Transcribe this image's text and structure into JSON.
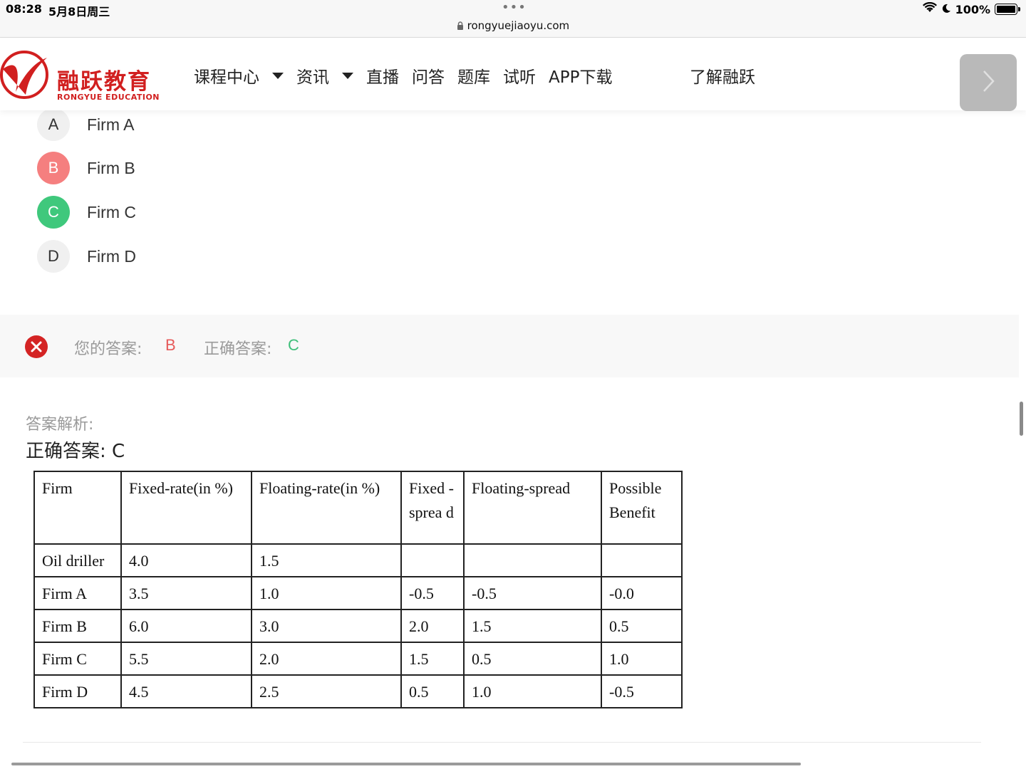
{
  "status_bar": {
    "time": "08:28",
    "date": "5月8日周三",
    "url": "rongyuejiaoyu.com",
    "battery": "100%"
  },
  "header": {
    "logo_cn": "融跃教育",
    "logo_en": "RONGYUE EDUCATION",
    "nav": [
      "课程中心",
      "资讯",
      "直播",
      "问答",
      "题库",
      "试听",
      "APP下载"
    ],
    "about": "了解融跃"
  },
  "options": [
    {
      "letter": "A",
      "text": "Firm A",
      "state": "normal"
    },
    {
      "letter": "B",
      "text": "Firm B",
      "state": "wrong"
    },
    {
      "letter": "C",
      "text": "Firm C",
      "state": "correct"
    },
    {
      "letter": "D",
      "text": "Firm D",
      "state": "normal"
    }
  ],
  "answer": {
    "your_label": "您的答案:",
    "your_value": "B",
    "correct_label": "正确答案:",
    "correct_value": "C",
    "colors": {
      "wrong": "#e65a5a",
      "correct": "#3fbf7a"
    }
  },
  "analysis": {
    "label": "答案解析:",
    "correct_line": "正确答案: C"
  },
  "table": {
    "headers": [
      "Firm",
      "Fixed-rate(in %)",
      "Floating-rate(in %)",
      "Fixed -sprea d",
      "Floating-spread",
      "Possible Benefit"
    ],
    "rows": [
      [
        "Oil driller",
        "4.0",
        "1.5",
        "",
        "",
        ""
      ],
      [
        "Firm A",
        "3.5",
        "1.0",
        "-0.5",
        "-0.5",
        "-0.0"
      ],
      [
        "Firm B",
        "6.0",
        "3.0",
        "2.0",
        "1.5",
        "0.5"
      ],
      [
        "Firm C",
        "5.5",
        "2.0",
        "1.5",
        "0.5",
        "1.0"
      ],
      [
        "Firm D",
        "4.5",
        "2.5",
        "0.5",
        "1.0",
        "-0.5"
      ]
    ]
  }
}
